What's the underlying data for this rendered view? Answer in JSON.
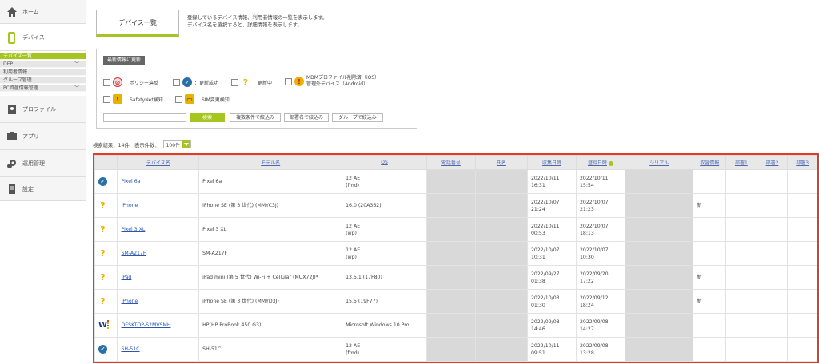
{
  "sidebar": {
    "home": "ホーム",
    "device": "デバイス",
    "sub": [
      "デバイス一覧",
      "DEP",
      "利用者情報",
      "グループ管理",
      "PC資産情報管理"
    ],
    "profile": "プロファイル",
    "app": "アプリ",
    "ops": "運用管理",
    "settings": "設定"
  },
  "header": {
    "title": "デバイス一覧",
    "desc1": "登録しているデバイス情報、利用者情報の一覧を表示します。",
    "desc2": "デバイス名を選択すると、詳細情報を表示します。"
  },
  "filter": {
    "refresh": "最新情報に更新",
    "policy": "：ポリシー違反",
    "success": "：更新成功",
    "updating": "：更新中",
    "mdm1": "MDMプロファイル削除済（iOS）",
    "mdm2": "管理外デバイス（Android）",
    "safetynet": "：SafetyNet検知",
    "sim": "：SIM変更検知",
    "search": "検索",
    "multi": "複数条件で絞込み",
    "dept": "部署名で絞込み",
    "group": "グループで絞込み"
  },
  "results": {
    "label": "検索結果：14件　表示件数：",
    "per_page": "100件"
  },
  "table": {
    "headers": [
      "",
      "デバイス名",
      "モデル名",
      "OS",
      "電話番号",
      "氏名",
      "収集日時",
      "登録日時",
      "シリアル",
      "収容情報",
      "部署1",
      "部署2",
      "部署3"
    ],
    "rows": [
      {
        "status": "ok",
        "name": "Pixel 6a",
        "model": "Pixel 6a",
        "os": "12 AE\n(fmd)",
        "collect": "2022/10/11\n16:31",
        "reg": "2022/10/11\n15:54",
        "note": ""
      },
      {
        "status": "q",
        "name": "iPhone",
        "model": "iPhone SE (第 3 世代) (MMYC3J)",
        "os": "16.0 (20A362)",
        "collect": "2022/10/07\n21:24",
        "reg": "2022/10/07\n21:23",
        "note": "新"
      },
      {
        "status": "q",
        "name": "Pixel 3 XL",
        "model": "Pixel 3 XL",
        "os": "12 AE\n(wp)",
        "collect": "2022/10/11\n00:53",
        "reg": "2022/10/07\n18:13",
        "note": ""
      },
      {
        "status": "q",
        "name": "SM-A217F",
        "model": "SM-A217F",
        "os": "12 AE\n(wp)",
        "collect": "2022/10/07\n10:31",
        "reg": "2022/10/07\n10:30",
        "note": ""
      },
      {
        "status": "q",
        "name": "iPad",
        "model": "iPad mini (第 5 世代) Wi-Fi + Cellular (MUX72J)*",
        "os": "13.5.1 (17F80)",
        "collect": "2022/09/27\n01:38",
        "reg": "2022/09/20\n17:22",
        "note": "新"
      },
      {
        "status": "q",
        "name": "iPhone",
        "model": "iPhone SE (第 3 世代) (MMYD3J)",
        "os": "15.5 (19F77)",
        "collect": "2022/10/03\n01:30",
        "reg": "2022/09/12\n18:24",
        "note": "新"
      },
      {
        "status": "w",
        "name": "DESKTOP-S2MVSMH",
        "model": "HP(HP ProBook 450 G3)",
        "os": "Microsoft Windows 10 Pro",
        "collect": "2022/09/08\n14:46",
        "reg": "2022/09/08\n14:27",
        "note": ""
      },
      {
        "status": "ok",
        "name": "SH-51C",
        "model": "SH-51C",
        "os": "12 AE\n(fmd)",
        "collect": "2022/10/11\n09:51",
        "reg": "2022/09/08\n13:28",
        "note": ""
      }
    ]
  }
}
